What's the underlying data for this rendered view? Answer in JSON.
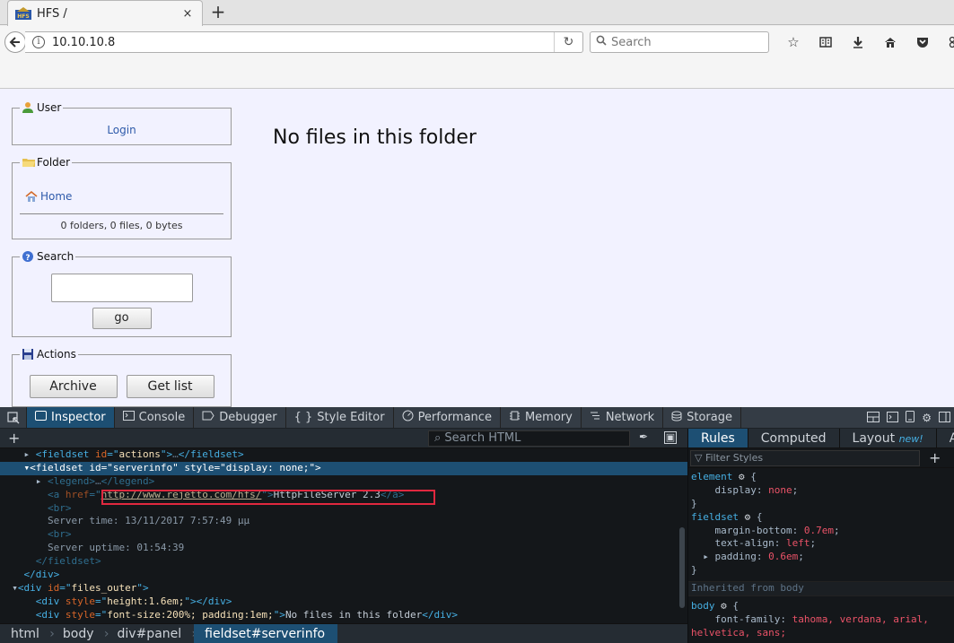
{
  "browser": {
    "tab_title": "HFS /",
    "tab_close": "×",
    "new_tab": "+",
    "url": "10.10.10.8",
    "search_placeholder": "Search",
    "icons": [
      "star-icon",
      "reader-icon",
      "download-icon",
      "home-icon",
      "pocket-icon",
      "extension-icon"
    ]
  },
  "page": {
    "user": {
      "legend": "User",
      "login": "Login"
    },
    "folder": {
      "legend": "Folder",
      "home": "Home",
      "stats": "0 folders, 0 files, 0 bytes"
    },
    "search": {
      "legend": "Search",
      "go": "go"
    },
    "actions": {
      "legend": "Actions",
      "archive": "Archive",
      "get_list": "Get list"
    },
    "empty_message": "No files in this folder"
  },
  "devtools": {
    "tabs": [
      {
        "id": "inspector",
        "label": "Inspector"
      },
      {
        "id": "console",
        "label": "Console"
      },
      {
        "id": "debugger",
        "label": "Debugger"
      },
      {
        "id": "style-editor",
        "label": "Style Editor"
      },
      {
        "id": "performance",
        "label": "Performance"
      },
      {
        "id": "memory",
        "label": "Memory"
      },
      {
        "id": "network",
        "label": "Network"
      },
      {
        "id": "storage",
        "label": "Storage"
      }
    ],
    "search_html_placeholder": "Search HTML",
    "markup": {
      "actions_line": {
        "tag": "fieldset",
        "attr": "id",
        "val": "actions",
        "close": "</fieldset>"
      },
      "serverinfo_line": {
        "tag": "fieldset",
        "attr1": "id",
        "val1": "serverinfo",
        "attr2": "style",
        "val2": "display: none;"
      },
      "legend_line": "<legend>",
      "legend_close": "</legend>",
      "link_href": "http://www.rejetto.com/hfs/",
      "link_text": "HttpFileServer 2.3",
      "br": "<br>",
      "server_time": "Server time: 13/11/2017 7:57:49 μμ",
      "server_uptime": "Server uptime: 01:54:39",
      "fieldset_close": "</fieldset>",
      "div_close": "</div>",
      "files_outer": {
        "attr": "id",
        "val": "files_outer"
      },
      "height_div": {
        "attr": "style",
        "val": "height:1.6em;"
      },
      "nofiles_div": {
        "attr": "style",
        "val": "font-size:200%; padding:1em;",
        "text": "No files in this folder"
      }
    },
    "breadcrumbs": [
      "html",
      "body",
      "div#panel",
      "fieldset#serverinfo"
    ],
    "rules_tabs": {
      "rules": "Rules",
      "computed": "Computed",
      "layout": "Layout",
      "layout_badge": "new!",
      "animations": "An"
    },
    "filter_placeholder": "Filter Styles",
    "rules": {
      "element_selector": "element",
      "element_prop": "display",
      "element_val": "none",
      "fieldset_selector": "fieldset",
      "fs_props": [
        {
          "prop": "margin-bottom",
          "val": "0.7em"
        },
        {
          "prop": "text-align",
          "val": "left"
        },
        {
          "prop": "padding",
          "val": "0.6em"
        }
      ],
      "inherited_label": "Inherited from body",
      "body_selector": "body",
      "body_prop": "font-family",
      "body_val_1": "tahoma, verdana, arial,",
      "body_val_2": "helvetica, sans;"
    }
  }
}
